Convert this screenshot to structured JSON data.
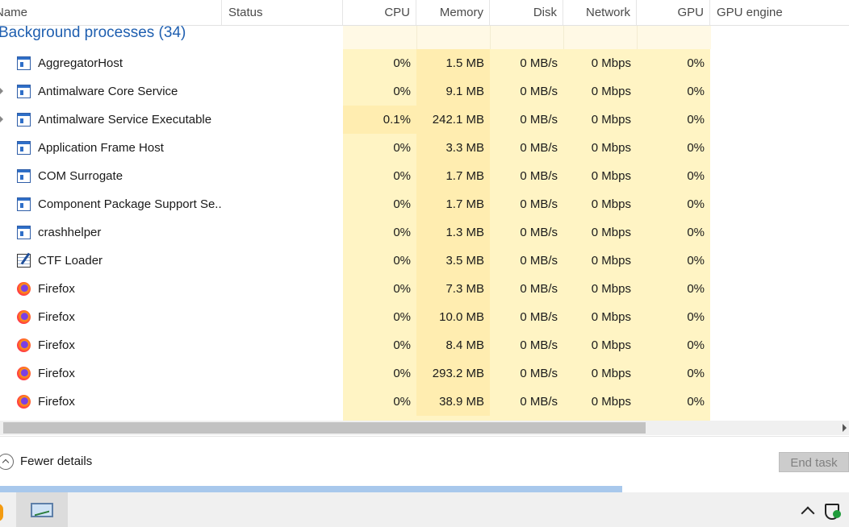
{
  "header": {
    "name": "Name",
    "status": "Status",
    "cpu": "CPU",
    "memory": "Memory",
    "disk": "Disk",
    "network": "Network",
    "gpu": "GPU",
    "gpu_engine": "GPU engine"
  },
  "group": {
    "title": "Background processes (34)"
  },
  "rows": [
    {
      "name": "AggregatorHost",
      "icon": "app-window-icon",
      "expandable": false,
      "cpu": "0%",
      "memory": "1.5 MB",
      "disk": "0 MB/s",
      "network": "0 Mbps",
      "gpu": "0%"
    },
    {
      "name": "Antimalware Core Service",
      "icon": "app-window-icon",
      "expandable": true,
      "cpu": "0%",
      "memory": "9.1 MB",
      "disk": "0 MB/s",
      "network": "0 Mbps",
      "gpu": "0%"
    },
    {
      "name": "Antimalware Service Executable",
      "icon": "app-window-icon",
      "expandable": true,
      "cpu": "0.1%",
      "memory": "242.1 MB",
      "disk": "0 MB/s",
      "network": "0 Mbps",
      "gpu": "0%"
    },
    {
      "name": "Application Frame Host",
      "icon": "app-window-icon",
      "expandable": false,
      "cpu": "0%",
      "memory": "3.3 MB",
      "disk": "0 MB/s",
      "network": "0 Mbps",
      "gpu": "0%"
    },
    {
      "name": "COM Surrogate",
      "icon": "app-window-icon",
      "expandable": false,
      "cpu": "0%",
      "memory": "1.7 MB",
      "disk": "0 MB/s",
      "network": "0 Mbps",
      "gpu": "0%"
    },
    {
      "name": "Component Package Support Se...",
      "icon": "app-window-icon",
      "expandable": false,
      "cpu": "0%",
      "memory": "1.7 MB",
      "disk": "0 MB/s",
      "network": "0 Mbps",
      "gpu": "0%"
    },
    {
      "name": "crashhelper",
      "icon": "app-window-icon",
      "expandable": false,
      "cpu": "0%",
      "memory": "1.3 MB",
      "disk": "0 MB/s",
      "network": "0 Mbps",
      "gpu": "0%"
    },
    {
      "name": "CTF Loader",
      "icon": "ctf-loader-icon",
      "expandable": false,
      "cpu": "0%",
      "memory": "3.5 MB",
      "disk": "0 MB/s",
      "network": "0 Mbps",
      "gpu": "0%"
    },
    {
      "name": "Firefox",
      "icon": "firefox-icon",
      "expandable": false,
      "cpu": "0%",
      "memory": "7.3 MB",
      "disk": "0 MB/s",
      "network": "0 Mbps",
      "gpu": "0%"
    },
    {
      "name": "Firefox",
      "icon": "firefox-icon",
      "expandable": false,
      "cpu": "0%",
      "memory": "10.0 MB",
      "disk": "0 MB/s",
      "network": "0 Mbps",
      "gpu": "0%"
    },
    {
      "name": "Firefox",
      "icon": "firefox-icon",
      "expandable": false,
      "cpu": "0%",
      "memory": "8.4 MB",
      "disk": "0 MB/s",
      "network": "0 Mbps",
      "gpu": "0%"
    },
    {
      "name": "Firefox",
      "icon": "firefox-icon",
      "expandable": false,
      "cpu": "0%",
      "memory": "293.2 MB",
      "disk": "0 MB/s",
      "network": "0 Mbps",
      "gpu": "0%"
    },
    {
      "name": "Firefox",
      "icon": "firefox-icon",
      "expandable": false,
      "cpu": "0%",
      "memory": "38.9 MB",
      "disk": "0 MB/s",
      "network": "0 Mbps",
      "gpu": "0%"
    }
  ],
  "footer": {
    "fewer_details": "Fewer details",
    "end_task": "End task"
  },
  "colors": {
    "heat_light": "#fff4c4",
    "heat_medium": "#ffedb0",
    "group_title": "#1f5fb0"
  }
}
